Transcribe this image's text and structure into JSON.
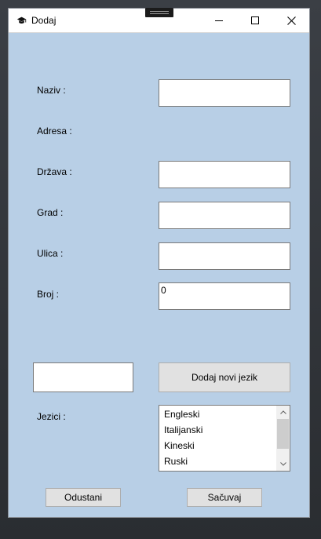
{
  "window": {
    "title": "Dodaj"
  },
  "form": {
    "naziv_label": "Naziv :",
    "naziv_value": "",
    "adresa_label": "Adresa :",
    "drzava_label": "Država :",
    "drzava_value": "",
    "grad_label": "Grad :",
    "grad_value": "",
    "ulica_label": "Ulica :",
    "ulica_value": "",
    "broj_label": "Broj :",
    "broj_value": "0"
  },
  "language": {
    "new_language_value": "",
    "add_button_label": "Dodaj novi jezik",
    "list_label": "Jezici :",
    "items": [
      "Engleski",
      "Italijanski",
      "Kineski",
      "Ruski"
    ]
  },
  "actions": {
    "cancel_label": "Odustani",
    "save_label": "Sačuvaj"
  },
  "icons": {
    "app": "graduation-cap-icon",
    "minimize": "minimize-icon",
    "maximize": "maximize-icon",
    "close": "close-icon",
    "scroll_up": "chevron-up-icon",
    "scroll_down": "chevron-down-icon"
  },
  "colors": {
    "background": "#b8cfe6",
    "titlebar": "#ffffff",
    "button": "#e1e1e1"
  }
}
